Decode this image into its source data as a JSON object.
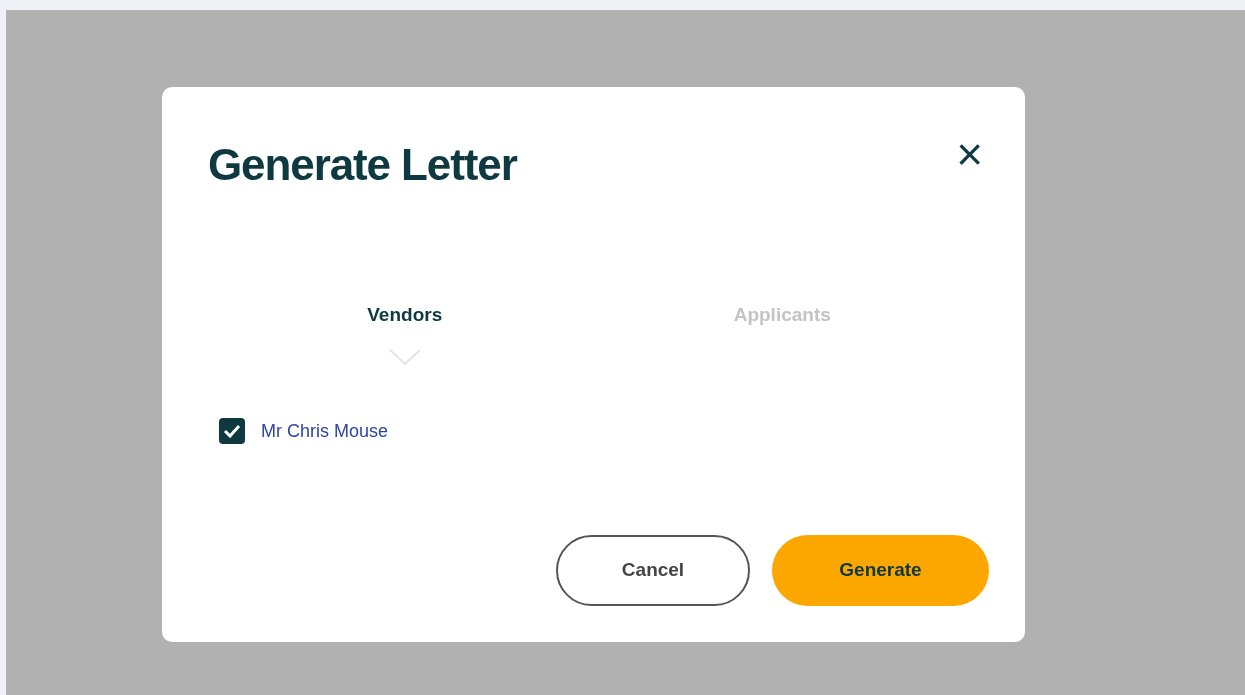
{
  "dialog": {
    "title": "Generate Letter",
    "close": "×"
  },
  "tabs": [
    {
      "label": "Vendors",
      "selected": true
    },
    {
      "label": "Applicants",
      "selected": false
    }
  ],
  "recipients": [
    {
      "name": "Mr Chris Mouse",
      "checked": true
    }
  ],
  "buttons": [
    {
      "label": "Cancel",
      "kind": "secondary"
    },
    {
      "label": "Generate",
      "kind": "primary"
    }
  ]
}
